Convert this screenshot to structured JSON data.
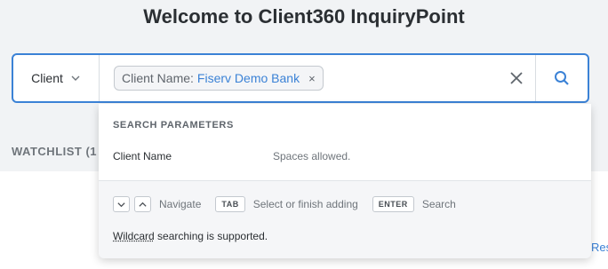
{
  "page": {
    "title": "Welcome to Client360 InquiryPoint"
  },
  "search": {
    "category": "Client",
    "chip": {
      "label": "Client Name:",
      "value": "Fiserv Demo Bank",
      "remove_symbol": "×"
    },
    "icons": {
      "category_dropdown": "chevron-down-icon",
      "clear": "close-icon",
      "submit": "search-icon"
    }
  },
  "watchlist": {
    "label": "WATCHLIST (1"
  },
  "link": {
    "text": "Res"
  },
  "dropdown": {
    "header": "SEARCH PARAMETERS",
    "params": [
      {
        "name": "Client Name",
        "description": "Spaces allowed."
      }
    ],
    "hints": {
      "navigate_label": "Navigate",
      "tab_key": "TAB",
      "tab_label": "Select or finish adding",
      "enter_key": "ENTER",
      "enter_label": "Search"
    },
    "wildcard": {
      "term": "Wildcard",
      "rest": " searching is supported."
    }
  },
  "colors": {
    "accent": "#3b82d6",
    "text": "#2b2f33",
    "muted": "#6f757b"
  }
}
